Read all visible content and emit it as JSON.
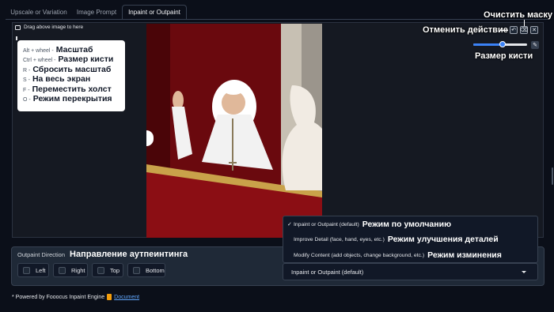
{
  "tabs": [
    {
      "label": "Upscale or Variation",
      "active": false
    },
    {
      "label": "Image Prompt",
      "active": false
    },
    {
      "label": "Inpaint or Outpaint",
      "active": true
    }
  ],
  "editor": {
    "drag_label": "Drag above image to here",
    "shortcuts": [
      {
        "key": "Alt + wheel -",
        "annotation": "Масштаб"
      },
      {
        "key": "Ctrl + wheel -",
        "annotation": "Размер кисти"
      },
      {
        "key": "R -",
        "annotation": "Сбросить масштаб"
      },
      {
        "key": "S -",
        "annotation": "На весь экран"
      },
      {
        "key": "F -",
        "annotation": "Переместить холст"
      },
      {
        "key": "O -",
        "annotation": "Режим перекрытия"
      }
    ],
    "controls": {
      "clear_mask_annotation": "Очистить маску",
      "undo_annotation": "Отменить действие",
      "brush_size_annotation": "Размер кисти",
      "undo_icon": "undo-icon",
      "clear_icon": "clear-mask-icon",
      "close_icon": "close-icon",
      "brush_size": 0.55
    }
  },
  "outpaint": {
    "label": "Outpaint Direction",
    "annotation": "Направление аутпеинтинга",
    "directions": [
      "Left",
      "Right",
      "Top",
      "Bottom"
    ]
  },
  "method_select": {
    "value": "Inpaint or Outpaint (default)",
    "options": [
      {
        "label": "Inpaint or Outpaint (default)",
        "annotation": "Режим по умолчанию",
        "selected": true
      },
      {
        "label": "Improve Detail (face, hand, eyes, etc.)",
        "annotation": "Режим улучшения деталей",
        "selected": false
      },
      {
        "label": "Modify Content (add objects, change background, etc.)",
        "annotation": "Режим изминения",
        "selected": false
      }
    ]
  },
  "footer": {
    "text": "* Powered by Fooocus Inpaint Engine",
    "link": "Document"
  },
  "colors": {
    "background": "#0b0f19",
    "accent": "#3b82f6",
    "panel": "#1f2937"
  }
}
